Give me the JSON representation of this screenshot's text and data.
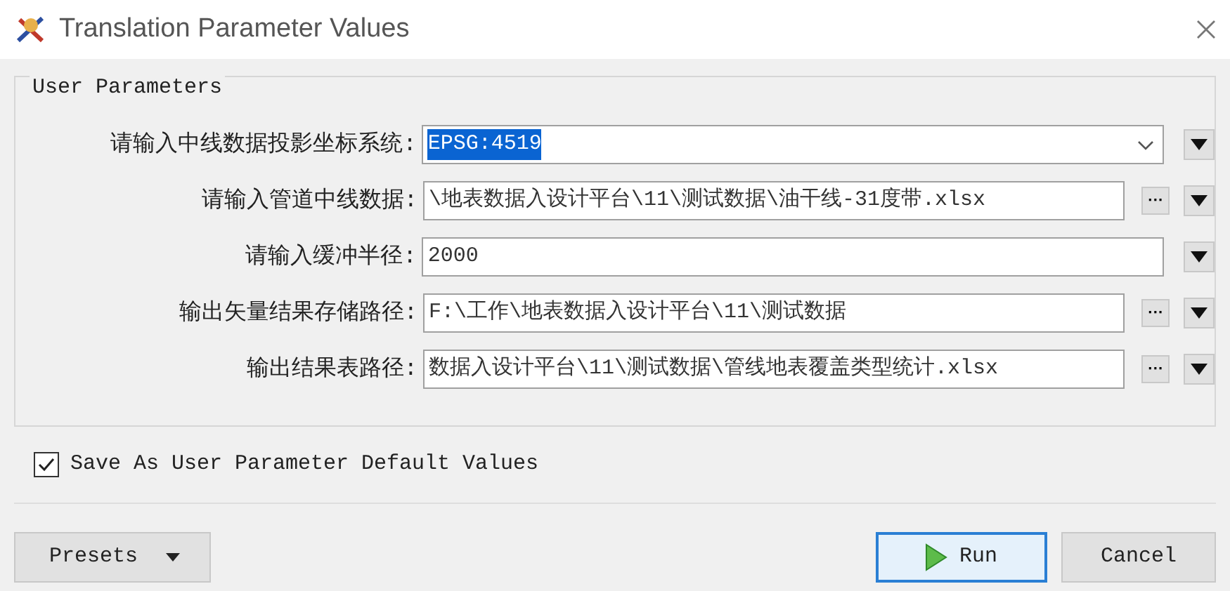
{
  "window": {
    "title": "Translation Parameter Values"
  },
  "group": {
    "title": "User Parameters"
  },
  "params": [
    {
      "label": "请输入中线数据投影坐标系统:",
      "value": "EPSG:4519",
      "kind": "dropdown",
      "highlighted": true
    },
    {
      "label": "请输入管道中线数据:",
      "value": "\\地表数据入设计平台\\11\\测试数据\\油干线-31度带.xlsx",
      "kind": "file",
      "highlighted": false
    },
    {
      "label": "请输入缓冲半径:",
      "value": "2000",
      "kind": "text",
      "highlighted": false
    },
    {
      "label": "输出矢量结果存储路径:",
      "value": "F:\\工作\\地表数据入设计平台\\11\\测试数据",
      "kind": "file",
      "highlighted": false
    },
    {
      "label": "输出结果表路径:",
      "value": "数据入设计平台\\11\\测试数据\\管线地表覆盖类型统计.xlsx",
      "kind": "file",
      "highlighted": false
    }
  ],
  "save_defaults": {
    "label": "Save As User Parameter Default Values",
    "checked": true
  },
  "buttons": {
    "presets": "Presets",
    "run": "Run",
    "cancel": "Cancel",
    "browse": "···"
  }
}
